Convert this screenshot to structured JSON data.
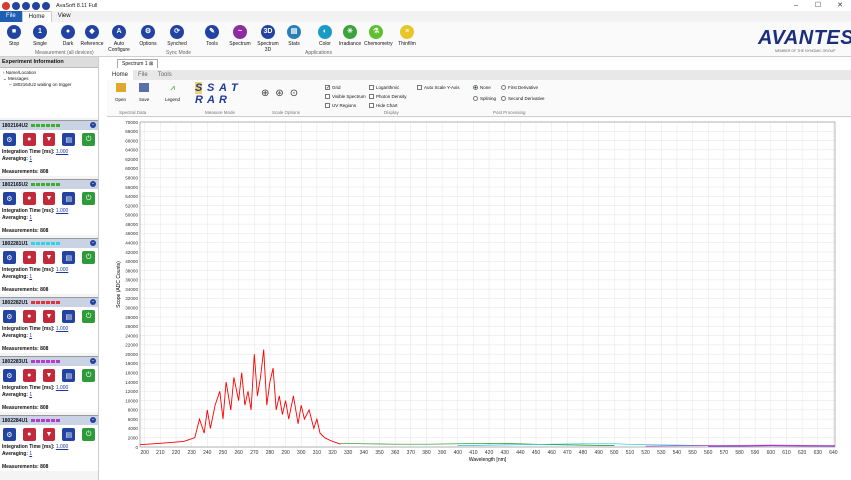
{
  "window": {
    "title": "AvaSoft 8.11 Full",
    "controls": [
      "–",
      "☐",
      "✕"
    ]
  },
  "quick_access": [
    {
      "icon": "record-icon",
      "color": "#d83a2f"
    },
    {
      "icon": "refresh-icon",
      "color": "#2343a0"
    },
    {
      "icon": "arrow-icon",
      "color": "#2343a0"
    },
    {
      "icon": "gear-icon",
      "color": "#2343a0"
    },
    {
      "icon": "save-icon",
      "color": "#2343a0"
    }
  ],
  "menu_tabs": [
    "File",
    "Home",
    "View"
  ],
  "ribbon": {
    "buttons": [
      {
        "label": "Stop",
        "icon": "stop-icon",
        "color": "#2343a0",
        "glyph": "■"
      },
      {
        "label": "Single",
        "icon": "single-icon",
        "color": "#2343a0",
        "glyph": "1"
      },
      {
        "label": "Dark",
        "icon": "dark-icon",
        "color": "#2343a0",
        "glyph": "●"
      },
      {
        "label": "Reference",
        "icon": "reference-icon",
        "color": "#2343a0",
        "glyph": "◆"
      },
      {
        "label": "Auto Configure",
        "icon": "auto-configure-icon",
        "color": "#2343a0",
        "glyph": "A"
      },
      {
        "label": "Options",
        "icon": "options-icon",
        "color": "#2343a0",
        "glyph": "⚙"
      },
      {
        "label": "Synched",
        "icon": "synched-icon",
        "color": "#2343a0",
        "glyph": "⟳"
      },
      {
        "label": "Tools",
        "icon": "tools-icon",
        "color": "#2343a0",
        "glyph": "✎"
      },
      {
        "label": "Spectrum",
        "icon": "spectrum-icon",
        "color": "#8c2ca0",
        "glyph": "~"
      },
      {
        "label": "Spectrum 3D",
        "icon": "spectrum-3d-icon",
        "color": "#2343a0",
        "glyph": "3D"
      },
      {
        "label": "Stats",
        "icon": "stats-icon",
        "color": "#2a7fb8",
        "glyph": "▤"
      },
      {
        "label": "Color",
        "icon": "color-icon",
        "color": "#1a9bc7",
        "glyph": "◐"
      },
      {
        "label": "Irradiance",
        "icon": "irradiance-icon",
        "color": "#3aa33a",
        "glyph": "☀"
      },
      {
        "label": "Chemometry",
        "icon": "chemometry-icon",
        "color": "#5fbf2f",
        "glyph": "⚗"
      },
      {
        "label": "Thinfilm",
        "icon": "thinfilm-icon",
        "color": "#e6c62a",
        "glyph": "≡"
      }
    ],
    "groups": [
      "Measurement (all devices)",
      "Sync Mode",
      "Applications"
    ]
  },
  "logo": {
    "text": "AVANTES",
    "subtitle": "MEMBER OF THE NYNOMIC GROUP"
  },
  "experiment": {
    "title": "Experiment Information",
    "tree": [
      "Name/Location",
      "Messages",
      "1802164U2 waiting on trigger"
    ]
  },
  "devices": [
    {
      "serial": "1802164U2",
      "led_color": "#3fae2e",
      "integration_label": "Integration Time [ms]:",
      "integration": "1.000",
      "averaging_label": "Averaging:",
      "averaging": "1",
      "measurements": "Measurements: 808"
    },
    {
      "serial": "1802165U2",
      "led_color": "#3fae2e",
      "integration_label": "Integration Time [ms]:",
      "integration": "1.000",
      "averaging_label": "Averaging:",
      "averaging": "1",
      "measurements": "Measurements: 808"
    },
    {
      "serial": "1802281U1",
      "led_color": "#2dd6e6",
      "integration_label": "Integration Time [ms]:",
      "integration": "1.000",
      "averaging_label": "Averaging:",
      "averaging": "1",
      "measurements": "Measurements: 808"
    },
    {
      "serial": "1802282U1",
      "led_color": "#e0343a",
      "integration_label": "Integration Time [ms]:",
      "integration": "1.000",
      "averaging_label": "Averaging:",
      "averaging": "1",
      "measurements": "Measurements: 808"
    },
    {
      "serial": "1802283U1",
      "led_color": "#b43ad0",
      "integration_label": "Integration Time [ms]:",
      "integration": "1.000",
      "averaging_label": "Averaging:",
      "averaging": "1",
      "measurements": "Measurements: 808"
    },
    {
      "serial": "1802284U1",
      "led_color": "#b43ad0",
      "integration_label": "Integration Time [ms]:",
      "integration": "1.000",
      "averaging_label": "Averaging:",
      "averaging": "1",
      "measurements": "Measurements: 808"
    }
  ],
  "device_buttons": [
    {
      "icon": "settings-icon",
      "color": "#2343a0",
      "glyph": "⚙"
    },
    {
      "icon": "dark-icon",
      "color": "#c02a3a",
      "glyph": "●"
    },
    {
      "icon": "reference-icon",
      "color": "#c02a3a",
      "glyph": "▼"
    },
    {
      "icon": "graph-icon",
      "color": "#2343a0",
      "glyph": "▤"
    },
    {
      "icon": "start-icon",
      "color": "#2d9b3a",
      "glyph": "⏻"
    }
  ],
  "doc_tab": "Spectrum 1",
  "sub_tabs": [
    "Home",
    "File",
    "Tools"
  ],
  "sub_ribbon": {
    "open": "Open",
    "save": "Save",
    "legend": "Legend",
    "spectral_data": "Spectral Data",
    "measure_mode": "Measure Mode",
    "mode_letters": [
      "S",
      "S",
      "A",
      "T",
      "R",
      "A",
      "R",
      ""
    ],
    "scale_options": "Scale Options",
    "display": "Display",
    "post_processing": "Post Processing",
    "checks": [
      {
        "label": "Grid",
        "checked": true
      },
      {
        "label": "Visible Spectrum",
        "checked": false
      },
      {
        "label": "UV Regions",
        "checked": false
      },
      {
        "label": "Logarithmic",
        "checked": false
      },
      {
        "label": "Photon Density",
        "checked": false
      },
      {
        "label": "Hide Chart",
        "checked": false
      },
      {
        "label": "Auto Scale Y-Axis",
        "checked": false
      }
    ],
    "radios": [
      {
        "label": "None",
        "checked": true
      },
      {
        "label": "Splining",
        "checked": false
      },
      {
        "label": "First Derivative",
        "checked": false
      },
      {
        "label": "Second Derivative",
        "checked": false
      }
    ]
  },
  "chart_data": {
    "type": "line",
    "xlabel": "Wavelength [nm]",
    "ylabel": "Scope (ADC Counts)",
    "xlim": [
      197,
      641
    ],
    "ylim": [
      0,
      70000
    ],
    "x_ticks": [
      200,
      210,
      220,
      230,
      240,
      250,
      260,
      270,
      280,
      290,
      300,
      310,
      320,
      330,
      340,
      350,
      360,
      370,
      380,
      390,
      400,
      410,
      420,
      430,
      440,
      450,
      460,
      470,
      480,
      490,
      500,
      510,
      520,
      530,
      540,
      550,
      560,
      570,
      580,
      590,
      600,
      610,
      620,
      630,
      640
    ],
    "y_ticks": [
      0,
      2000,
      4000,
      6000,
      8000,
      10000,
      12000,
      14000,
      16000,
      18000,
      20000,
      22000,
      24000,
      26000,
      28000,
      30000,
      32000,
      34000,
      36000,
      38000,
      40000,
      42000,
      44000,
      46000,
      48000,
      50000,
      52000,
      54000,
      56000,
      58000,
      60000,
      62000,
      64000,
      66000,
      68000,
      70000
    ],
    "grid": true,
    "series": [
      {
        "color": "#ff0000",
        "x": [
          197,
          210,
          225,
          232,
          235,
          238,
          240,
          242,
          245,
          248,
          250,
          252,
          255,
          257,
          260,
          262,
          264,
          266,
          268,
          270,
          272,
          274,
          276,
          278,
          280,
          282,
          284,
          286,
          288,
          290,
          292,
          295,
          298,
          300,
          302,
          305,
          308,
          310,
          312,
          315,
          318,
          320,
          322,
          325
        ],
        "y": [
          500,
          800,
          1200,
          2000,
          6000,
          3000,
          8000,
          4000,
          9000,
          12000,
          6000,
          14000,
          8000,
          15000,
          10000,
          16000,
          9000,
          12000,
          8000,
          20000,
          11000,
          15000,
          21000,
          9000,
          14000,
          17000,
          8000,
          11000,
          7000,
          10000,
          6000,
          11000,
          5000,
          9000,
          6000,
          8000,
          4000,
          6000,
          3000,
          2000,
          1500,
          1200,
          1000,
          600
        ]
      },
      {
        "color": "#1f8a1f",
        "x": [
          325,
          340,
          360,
          380,
          400,
          420,
          440,
          460,
          480,
          500
        ],
        "y": [
          800,
          700,
          600,
          600,
          700,
          800,
          700,
          500,
          400,
          300
        ]
      },
      {
        "color": "#15c7d8",
        "x": [
          400,
          420,
          440,
          460,
          480,
          500,
          520,
          540,
          560,
          580
        ],
        "y": [
          300,
          400,
          500,
          600,
          700,
          700,
          500,
          400,
          300,
          200
        ]
      },
      {
        "color": "#d03ad0",
        "x": [
          520,
          540,
          560,
          580,
          600,
          620,
          641
        ],
        "y": [
          200,
          250,
          300,
          350,
          400,
          350,
          300
        ]
      },
      {
        "color": "#7a2ad0",
        "x": [
          560,
          580,
          600,
          620,
          641
        ],
        "y": [
          150,
          200,
          250,
          220,
          200
        ]
      }
    ]
  }
}
